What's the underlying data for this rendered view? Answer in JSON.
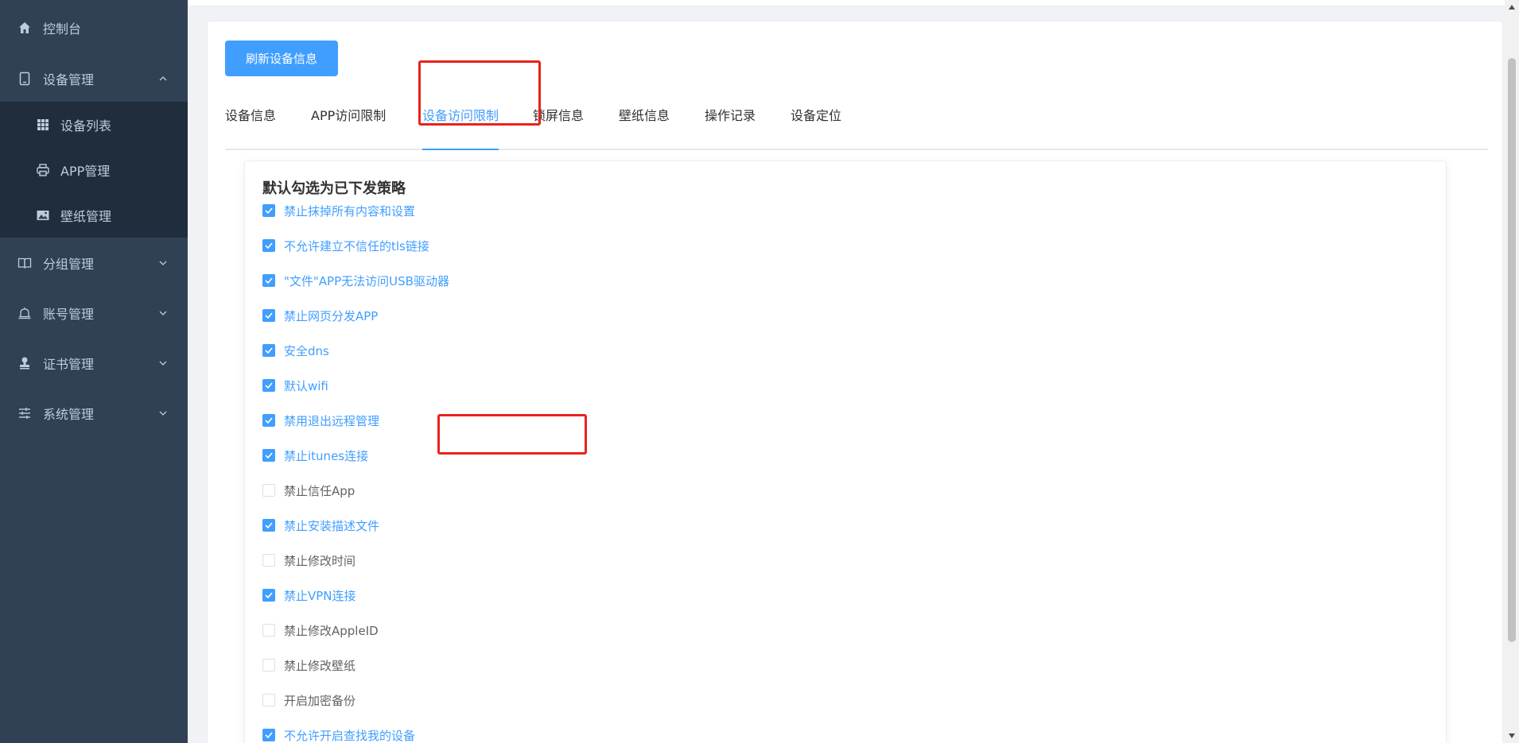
{
  "sidebar": {
    "items": [
      {
        "label": "控制台",
        "icon": "home-icon"
      },
      {
        "label": "设备管理",
        "icon": "tablet-icon",
        "expanded": true,
        "children": [
          {
            "label": "设备列表",
            "icon": "grid-icon"
          },
          {
            "label": "APP管理",
            "icon": "printer-icon"
          },
          {
            "label": "壁纸管理",
            "icon": "picture-icon"
          }
        ]
      },
      {
        "label": "分组管理",
        "icon": "book-icon"
      },
      {
        "label": "账号管理",
        "icon": "bell-icon"
      },
      {
        "label": "证书管理",
        "icon": "stamp-icon"
      },
      {
        "label": "系统管理",
        "icon": "sliders-icon"
      }
    ]
  },
  "toolbar": {
    "refresh_label": "刷新设备信息"
  },
  "tabs": [
    {
      "label": "设备信息"
    },
    {
      "label": "APP访问限制"
    },
    {
      "label": "设备访问限制",
      "active": true
    },
    {
      "label": "锁屏信息"
    },
    {
      "label": "壁纸信息"
    },
    {
      "label": "操作记录"
    },
    {
      "label": "设备定位"
    }
  ],
  "panel": {
    "title": "默认勾选为已下发策略",
    "options": [
      {
        "label": "禁止抹掉所有内容和设置",
        "checked": true
      },
      {
        "label": "不允许建立不信任的tls链接",
        "checked": true
      },
      {
        "label": "\"文件\"APP无法访问USB驱动器",
        "checked": true
      },
      {
        "label": "禁止网页分发APP",
        "checked": true
      },
      {
        "label": "安全dns",
        "checked": true
      },
      {
        "label": "默认wifi",
        "checked": true
      },
      {
        "label": "禁用退出远程管理",
        "checked": true
      },
      {
        "label": "禁止itunes连接",
        "checked": true
      },
      {
        "label": "禁止信任App",
        "checked": false
      },
      {
        "label": "禁止安装描述文件",
        "checked": true
      },
      {
        "label": "禁止修改时间",
        "checked": false
      },
      {
        "label": "禁止VPN连接",
        "checked": true
      },
      {
        "label": "禁止修改AppleID",
        "checked": false
      },
      {
        "label": "禁止修改壁纸",
        "checked": false
      },
      {
        "label": "开启加密备份",
        "checked": false
      },
      {
        "label": "不允许开启查找我的设备",
        "checked": true
      }
    ]
  },
  "colors": {
    "accent": "#409eff",
    "sidebar_bg": "#304156",
    "submenu_bg": "#1f2d3d",
    "highlight": "#e8231c"
  }
}
